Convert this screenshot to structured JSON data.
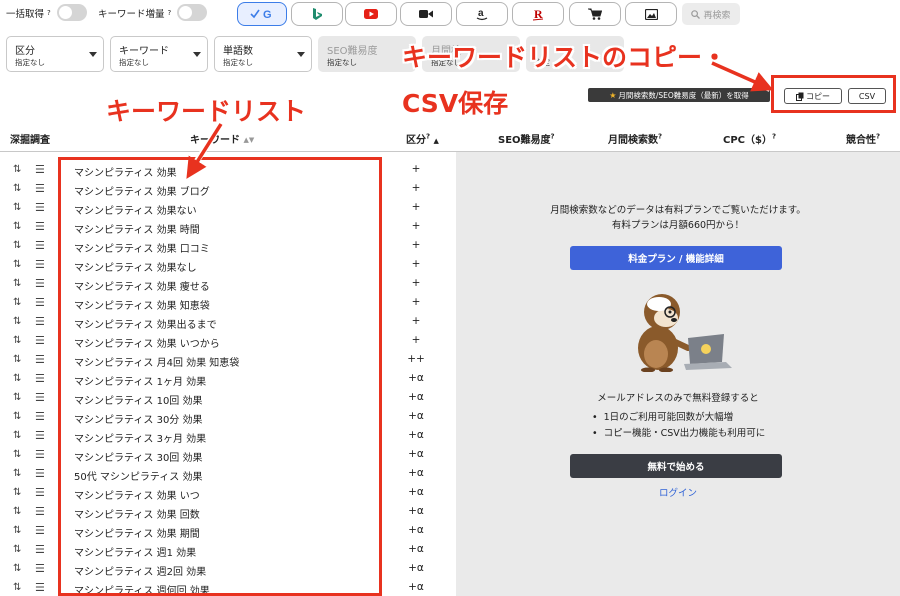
{
  "toolbar": {
    "bulk_fetch": {
      "label": "一括取得",
      "help": "?"
    },
    "keyword_boost": {
      "label": "キーワード増量",
      "help": "?"
    },
    "engines": [
      {
        "name": "google",
        "icon": "google-icon",
        "active": true,
        "color": "#3c7de8"
      },
      {
        "name": "bing",
        "icon": "bing-icon",
        "active": false,
        "color": "#1f8c6e"
      },
      {
        "name": "youtube",
        "icon": "youtube-icon",
        "active": false,
        "color": "#e62117"
      },
      {
        "name": "video",
        "icon": "video-camera-icon",
        "active": false,
        "color": "#222222"
      },
      {
        "name": "amazon",
        "icon": "amazon-icon",
        "active": false,
        "color": "#222222"
      },
      {
        "name": "rakuten",
        "icon": "rakuten-icon",
        "active": false,
        "color": "#bf0000"
      },
      {
        "name": "shopping",
        "icon": "shopping-cart-icon",
        "active": false,
        "color": "#222222"
      },
      {
        "name": "images",
        "icon": "image-icon",
        "active": false,
        "color": "#222222"
      }
    ],
    "reload_label": "再検索"
  },
  "filters": [
    {
      "label": "区分",
      "value": "指定なし",
      "enabled": true
    },
    {
      "label": "キーワード",
      "value": "指定なし",
      "enabled": true
    },
    {
      "label": "単語数",
      "value": "指定なし",
      "enabled": true
    },
    {
      "label": "SEO難易度",
      "value": "指定なし",
      "enabled": false
    },
    {
      "label": "月間検",
      "value": "指定なし",
      "enabled": false
    },
    {
      "label": "",
      "value": "指定",
      "enabled": false
    }
  ],
  "actions": {
    "premium_label": "月間検索数/SEO難易度（最新）を取得",
    "copy_label": "コピー",
    "csv_label": "CSV"
  },
  "table": {
    "headers": {
      "deep_dive": "深掘調査",
      "keyword": "キーワード",
      "category": "区分",
      "seo": "SEO難易度",
      "volume": "月間検索数",
      "cpc": "CPC（$）",
      "competition": "競合性",
      "help": "?"
    },
    "rows": [
      {
        "keyword": "マシンピラティス 効果",
        "category": "+"
      },
      {
        "keyword": "マシンピラティス 効果 ブログ",
        "category": "+"
      },
      {
        "keyword": "マシンピラティス 効果ない",
        "category": "+"
      },
      {
        "keyword": "マシンピラティス 効果 時間",
        "category": "+"
      },
      {
        "keyword": "マシンピラティス 効果 口コミ",
        "category": "+"
      },
      {
        "keyword": "マシンピラティス 効果なし",
        "category": "+"
      },
      {
        "keyword": "マシンピラティス 効果 痩せる",
        "category": "+"
      },
      {
        "keyword": "マシンピラティス 効果 知恵袋",
        "category": "+"
      },
      {
        "keyword": "マシンピラティス 効果出るまで",
        "category": "+"
      },
      {
        "keyword": "マシンピラティス 効果 いつから",
        "category": "+"
      },
      {
        "keyword": "マシンピラティス 月4回 効果 知恵袋",
        "category": "++"
      },
      {
        "keyword": "マシンピラティス 1ヶ月 効果",
        "category": "+α"
      },
      {
        "keyword": "マシンピラティス 10回 効果",
        "category": "+α"
      },
      {
        "keyword": "マシンピラティス 30分 効果",
        "category": "+α"
      },
      {
        "keyword": "マシンピラティス 3ヶ月 効果",
        "category": "+α"
      },
      {
        "keyword": "マシンピラティス 30回 効果",
        "category": "+α"
      },
      {
        "keyword": "50代 マシンピラティス 効果",
        "category": "+α"
      },
      {
        "keyword": "マシンピラティス 効果 いつ",
        "category": "+α"
      },
      {
        "keyword": "マシンピラティス 効果 回数",
        "category": "+α"
      },
      {
        "keyword": "マシンピラティス 効果 期間",
        "category": "+α"
      },
      {
        "keyword": "マシンピラティス 週1 効果",
        "category": "+α"
      },
      {
        "keyword": "マシンピラティス 週2回 効果",
        "category": "+α"
      },
      {
        "keyword": "マシンピラティス 週何回 効果",
        "category": "+α"
      }
    ]
  },
  "panel": {
    "line1": "月間検索数などのデータは有料プランでご覧いただけます。",
    "line2": "有料プランは月額660円から！",
    "plan_button": "料金プラン / 機能詳細",
    "signup_text": "メールアドレスのみで無料登録すると",
    "bullets": [
      "1日のご利用可能回数が大幅増",
      "コピー機能・CSV出力機能も利用可に"
    ],
    "start_button": "無料で始める",
    "login_link": "ログイン"
  },
  "annotations": {
    "keyword_list": "キーワードリスト",
    "copy_csv_line1": "キーワードリストのコピー・",
    "copy_csv_line2": "CSV保存",
    "color": "#e8321f"
  }
}
